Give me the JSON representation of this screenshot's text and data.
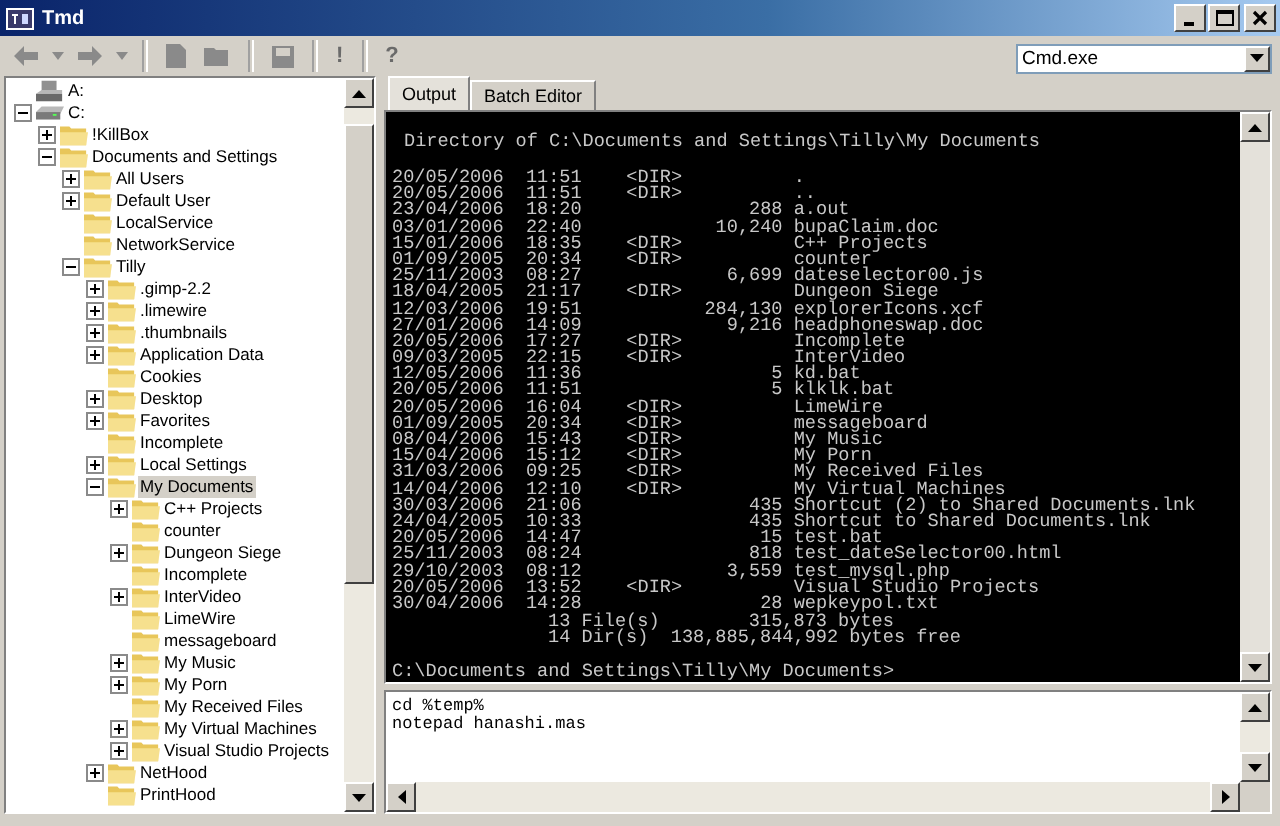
{
  "window": {
    "title": "Tmd"
  },
  "toolbar": {
    "buttons": [
      {
        "kind": "back",
        "disabled": true
      },
      {
        "kind": "menu",
        "disabled": true
      },
      {
        "kind": "forward",
        "disabled": true
      },
      {
        "kind": "menu",
        "disabled": true
      },
      {
        "kind": "new",
        "disabled": true
      },
      {
        "kind": "open",
        "disabled": true
      },
      {
        "kind": "save",
        "disabled": true
      },
      {
        "kind": "text",
        "label": "!",
        "disabled": true
      },
      {
        "kind": "text",
        "label": "?",
        "disabled": true
      }
    ],
    "shell_combo": {
      "value": "Cmd.exe"
    }
  },
  "tree": {
    "items": [
      {
        "label": "A:",
        "kind": "floppy",
        "expandable": false,
        "selected": false
      },
      {
        "label": "C:",
        "kind": "drive",
        "expandable": true,
        "expanded": true,
        "selected": false,
        "children": [
          {
            "label": "!KillBox",
            "kind": "folder",
            "expandable": true,
            "expanded": false,
            "selected": false
          },
          {
            "label": "Documents and Settings",
            "kind": "folder",
            "expandable": true,
            "expanded": true,
            "selected": false,
            "children": [
              {
                "label": "All Users",
                "kind": "folder",
                "expandable": true,
                "expanded": false,
                "selected": false
              },
              {
                "label": "Default User",
                "kind": "folder",
                "expandable": true,
                "expanded": false,
                "selected": false
              },
              {
                "label": "LocalService",
                "kind": "folder",
                "expandable": false,
                "selected": false
              },
              {
                "label": "NetworkService",
                "kind": "folder",
                "expandable": false,
                "selected": false
              },
              {
                "label": "Tilly",
                "kind": "folder",
                "expandable": true,
                "expanded": true,
                "selected": false,
                "children": [
                  {
                    "label": ".gimp-2.2",
                    "kind": "folder",
                    "expandable": true,
                    "expanded": false,
                    "selected": false
                  },
                  {
                    "label": ".limewire",
                    "kind": "folder",
                    "expandable": true,
                    "expanded": false,
                    "selected": false
                  },
                  {
                    "label": ".thumbnails",
                    "kind": "folder",
                    "expandable": true,
                    "expanded": false,
                    "selected": false
                  },
                  {
                    "label": "Application Data",
                    "kind": "folder",
                    "expandable": true,
                    "expanded": false,
                    "selected": false
                  },
                  {
                    "label": "Cookies",
                    "kind": "folder",
                    "expandable": false,
                    "selected": false
                  },
                  {
                    "label": "Desktop",
                    "kind": "folder",
                    "expandable": true,
                    "expanded": false,
                    "selected": false
                  },
                  {
                    "label": "Favorites",
                    "kind": "folder",
                    "expandable": true,
                    "expanded": false,
                    "selected": false
                  },
                  {
                    "label": "Incomplete",
                    "kind": "folder",
                    "expandable": false,
                    "selected": false
                  },
                  {
                    "label": "Local Settings",
                    "kind": "folder",
                    "expandable": true,
                    "expanded": false,
                    "selected": false
                  },
                  {
                    "label": "My Documents",
                    "kind": "folder",
                    "expandable": true,
                    "expanded": true,
                    "selected": true,
                    "children": [
                      {
                        "label": "C++ Projects",
                        "kind": "folder",
                        "expandable": true,
                        "expanded": false,
                        "selected": false
                      },
                      {
                        "label": "counter",
                        "kind": "folder",
                        "expandable": false,
                        "selected": false
                      },
                      {
                        "label": "Dungeon Siege",
                        "kind": "folder",
                        "expandable": true,
                        "expanded": false,
                        "selected": false
                      },
                      {
                        "label": "Incomplete",
                        "kind": "folder",
                        "expandable": false,
                        "selected": false
                      },
                      {
                        "label": "InterVideo",
                        "kind": "folder",
                        "expandable": true,
                        "expanded": false,
                        "selected": false
                      },
                      {
                        "label": "LimeWire",
                        "kind": "folder",
                        "expandable": false,
                        "selected": false
                      },
                      {
                        "label": "messageboard",
                        "kind": "folder",
                        "expandable": false,
                        "selected": false
                      },
                      {
                        "label": "My Music",
                        "kind": "folder",
                        "expandable": true,
                        "expanded": false,
                        "selected": false
                      },
                      {
                        "label": "My Porn",
                        "kind": "folder",
                        "expandable": true,
                        "expanded": false,
                        "selected": false
                      },
                      {
                        "label": "My Received Files",
                        "kind": "folder",
                        "expandable": false,
                        "selected": false
                      },
                      {
                        "label": "My Virtual Machines",
                        "kind": "folder",
                        "expandable": true,
                        "expanded": false,
                        "selected": false
                      },
                      {
                        "label": "Visual Studio Projects",
                        "kind": "folder",
                        "expandable": true,
                        "expanded": false,
                        "selected": false
                      }
                    ]
                  },
                  {
                    "label": "NetHood",
                    "kind": "folder",
                    "expandable": true,
                    "expanded": false,
                    "selected": false
                  },
                  {
                    "label": "PrintHood",
                    "kind": "folder",
                    "expandable": false,
                    "selected": false
                  }
                ]
              }
            ]
          }
        ]
      }
    ]
  },
  "tabs": [
    {
      "label": "Output",
      "selected": true
    },
    {
      "label": "Batch Editor",
      "selected": false
    }
  ],
  "console": {
    "header": "Directory of C:\\Documents and Settings\\Tilly\\My Documents",
    "entries": [
      "20/05/2006  11:51    <DIR>          .",
      "20/05/2006  11:51    <DIR>          ..",
      "23/04/2006  18:20               288 a.out",
      "03/01/2006  22:40            10,240 bupaClaim.doc",
      "15/01/2006  18:35    <DIR>          C++ Projects",
      "01/09/2005  20:34    <DIR>          counter",
      "25/11/2003  08:27             6,699 dateselector00.js",
      "18/04/2005  21:17    <DIR>          Dungeon Siege",
      "12/03/2006  19:51           284,130 explorerIcons.xcf",
      "27/01/2006  14:09             9,216 headphoneswap.doc",
      "20/05/2006  17:27    <DIR>          Incomplete",
      "09/03/2005  22:15    <DIR>          InterVideo",
      "12/05/2006  11:36                 5 kd.bat",
      "20/05/2006  11:51                 5 klklk.bat",
      "20/05/2006  16:04    <DIR>          LimeWire",
      "01/09/2005  20:34    <DIR>          messageboard",
      "08/04/2006  15:43    <DIR>          My Music",
      "15/04/2006  15:12    <DIR>          My Porn",
      "31/03/2006  09:25    <DIR>          My Received Files",
      "14/04/2006  12:10    <DIR>          My Virtual Machines",
      "30/03/2006  21:06               435 Shortcut (2) to Shared Documents.lnk",
      "24/04/2005  10:33               435 Shortcut to Shared Documents.lnk",
      "20/05/2006  14:47                15 test.bat",
      "25/11/2003  08:24               818 test_dateSelector00.html",
      "29/10/2003  08:12             3,559 test_mysql.php",
      "20/05/2006  13:52    <DIR>          Visual Studio Projects",
      "30/04/2006  14:28                28 wepkeypol.txt"
    ],
    "summary": [
      "13 File(s)        315,873 bytes",
      "14 Dir(s)  138,885,844,992 bytes free"
    ],
    "prompt": "C:\\Documents and Settings\\Tilly\\My Documents>"
  },
  "batch_input": {
    "lines": [
      "cd %temp%",
      "notepad hanashi.mas"
    ]
  }
}
